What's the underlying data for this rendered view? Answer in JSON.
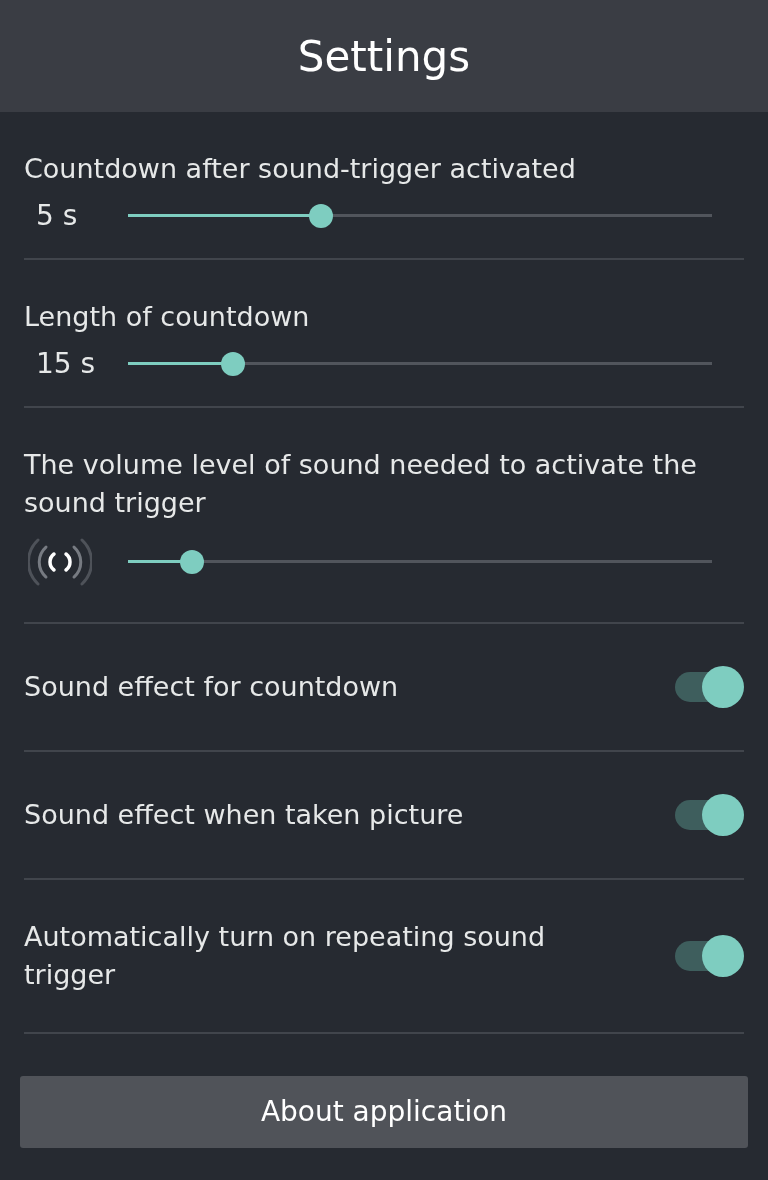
{
  "header": {
    "title": "Settings"
  },
  "sliders": [
    {
      "label": "Countdown after sound-trigger activated",
      "kind": "reading",
      "reading": "5 s",
      "level": 0.33
    },
    {
      "label": "Length of countdown",
      "kind": "reading",
      "reading": "15 s",
      "level": 0.18
    },
    {
      "label": "The volume level of sound needed to activate the sound trigger",
      "kind": "icon",
      "level": 0.11
    }
  ],
  "toggles": [
    {
      "label": "Sound effect for countdown",
      "on": true
    },
    {
      "label": "Sound effect when taken picture",
      "on": true
    },
    {
      "label": "Automatically turn on repeating sound trigger",
      "on": true
    }
  ],
  "button": {
    "label": "About application"
  }
}
